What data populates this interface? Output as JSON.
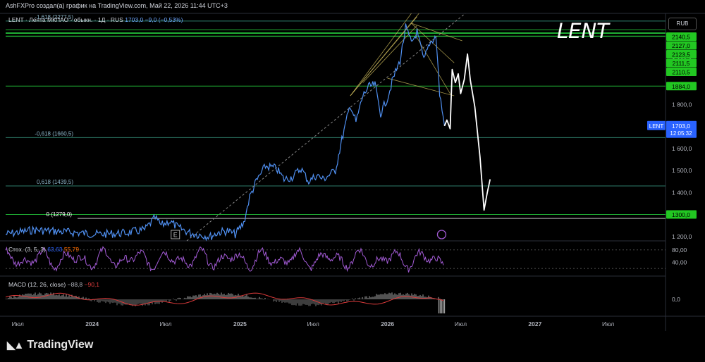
{
  "header": {
    "caption": "AshFXPro создал(а) график на TradingView.com, Май 22, 2026 11:44 UTC+3"
  },
  "symbol": {
    "title": "LENT · Лента МКПАО - обыкн. · 1Д · RUS",
    "price": "1703,0",
    "change": "−9,0 (−0,53%)",
    "big_label": "LENT",
    "currency": "RUB",
    "price_tag": "LENT",
    "price_value": "1703,0",
    "countdown": "12:05:32"
  },
  "colors": {
    "price_line": "#4f8ff0",
    "projection": "#ffffff",
    "hline": "#1fae33",
    "green_badge": "#22c722",
    "stoch": "#a35bd6",
    "macd": "#d93a3a",
    "fib_text": "#8cb4c8",
    "trendline": "#c8b65a"
  },
  "chart_data": [
    {
      "type": "line",
      "name": "price",
      "ylim": [
        1180,
        2215
      ],
      "x": [
        "2023-06-01",
        "2023-08-10",
        "2023-11-01",
        "2024-01-15",
        "2024-03-20",
        "2024-05-10",
        "2024-06-05",
        "2024-06-20",
        "2024-07-10",
        "2024-08-01",
        "2024-09-01",
        "2024-10-01",
        "2024-10-20",
        "2024-11-10",
        "2024-12-01",
        "2024-12-20",
        "2025-01-10",
        "2025-01-25",
        "2025-02-10",
        "2025-03-05",
        "2025-04-01",
        "2025-04-20",
        "2025-05-10",
        "2025-06-01",
        "2025-06-20",
        "2025-07-10",
        "2025-07-25",
        "2025-08-10",
        "2025-08-25",
        "2025-09-10",
        "2025-10-01",
        "2025-10-15",
        "2025-11-01",
        "2025-11-15",
        "2025-12-01",
        "2025-12-15",
        "2026-01-01",
        "2026-01-15",
        "2026-02-01",
        "2026-02-15",
        "2026-03-01",
        "2026-03-15",
        "2026-04-01",
        "2026-04-15",
        "2026-05-01",
        "2026-05-10",
        "2026-05-22"
      ],
      "y": [
        1210,
        1230,
        1220,
        1210,
        1215,
        1230,
        1285,
        1250,
        1270,
        1240,
        1215,
        1205,
        1200,
        1220,
        1225,
        1210,
        1260,
        1380,
        1450,
        1520,
        1510,
        1460,
        1470,
        1510,
        1450,
        1480,
        1460,
        1480,
        1500,
        1640,
        1800,
        1720,
        1840,
        1880,
        1890,
        1760,
        1830,
        1920,
        2000,
        2150,
        2080,
        2130,
        2000,
        2080,
        2110,
        1850,
        1703
      ],
      "xlim": [
        "2023-06-01",
        "2027-11-20"
      ],
      "x_ticks": [
        "Июл",
        "2024",
        "Июл",
        "2025",
        "Июл",
        "2026",
        "Июл",
        "2027",
        "Июл"
      ],
      "y_ticks": [
        "2 000,0",
        "1 800,0",
        "1 600,0",
        "1 500,0",
        "1 400,0",
        "1 200,0"
      ]
    },
    {
      "type": "line",
      "name": "forecast",
      "x": [
        "2026-05-22",
        "2026-05-28",
        "2026-06-05",
        "2026-06-10",
        "2026-06-18",
        "2026-06-25",
        "2026-07-01",
        "2026-07-10",
        "2026-07-18",
        "2026-07-25",
        "2026-08-05",
        "2026-08-18",
        "2026-08-28",
        "2026-09-05",
        "2026-09-12"
      ],
      "y": [
        1703,
        1730,
        1690,
        1960,
        1900,
        1940,
        1850,
        1915,
        2030,
        1910,
        1790,
        1560,
        1320,
        1400,
        1460
      ]
    },
    {
      "type": "line",
      "name": "levels",
      "levels": [
        {
          "value": 2140.5,
          "label": "2140,5"
        },
        {
          "value": 2127.0,
          "label": "2127,0"
        },
        {
          "value": 2123.5,
          "label": "2123,5"
        },
        {
          "value": 2111.5,
          "label": "2111,5"
        },
        {
          "value": 2110.5,
          "label": "2110,5"
        },
        {
          "value": 1884.0,
          "label": "1884,0"
        },
        {
          "value": 1300.0,
          "label": "1300,0"
        }
      ],
      "fib_levels": [
        {
          "value": 2180,
          "label": "-1,618 (2277,5)"
        },
        {
          "value": 1650,
          "label": "-0,618 (1660,5)"
        },
        {
          "value": 1430,
          "label": "0,618 (1439,5)"
        },
        {
          "value": 1282,
          "label": "0 (1279,0)"
        }
      ]
    },
    {
      "type": "line",
      "name": "stochastic",
      "title": "Стох. (3, 5, 3)",
      "values_text": [
        "63,63",
        "55,79"
      ],
      "y_ticks": [
        "80,00",
        "40,00"
      ],
      "ylim": [
        0,
        100
      ]
    },
    {
      "type": "bar",
      "name": "macd",
      "title": "MACD (12, 26, close)",
      "values_text": [
        "−88,8",
        "−90,1"
      ],
      "y_ticks": [
        "0,0"
      ]
    }
  ],
  "branding": {
    "logo_text": "TradingView",
    "event_marker": "E"
  }
}
